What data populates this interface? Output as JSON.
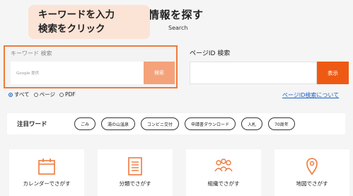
{
  "header": {
    "title": "情報を探す",
    "subtitle": "Search"
  },
  "callout": {
    "line1": "キーワードを入力",
    "line2": "検索をクリック"
  },
  "keyword_search": {
    "label": "キーワード 検索",
    "input_placeholder": "Google 提供",
    "button_label": "検索"
  },
  "page_id_search": {
    "label": "ページID 検索",
    "input_value": "",
    "button_label": "表示",
    "help_link": "ページID検索について"
  },
  "filters": {
    "options": [
      {
        "label": "すべて",
        "selected": true
      },
      {
        "label": "ページ",
        "selected": false
      },
      {
        "label": "PDF",
        "selected": false
      }
    ]
  },
  "featured": {
    "title": "注目ワード",
    "chips": [
      "ごみ",
      "湯の山温泉",
      "コンビニ交付",
      "申請書ダウンロード",
      "入札",
      "70周年"
    ]
  },
  "cards": [
    {
      "label": "カレンダーでさがす",
      "icon": "calendar-icon"
    },
    {
      "label": "分類でさがす",
      "icon": "list-document-icon"
    },
    {
      "label": "組織でさがす",
      "icon": "people-icon"
    },
    {
      "label": "地図でさがす",
      "icon": "map-pin-icon"
    }
  ],
  "colors": {
    "accent": "#ee5a14",
    "accent_light": "#f4a27a",
    "callout_bg": "#fbe3d6",
    "link": "#1f5fbf"
  }
}
